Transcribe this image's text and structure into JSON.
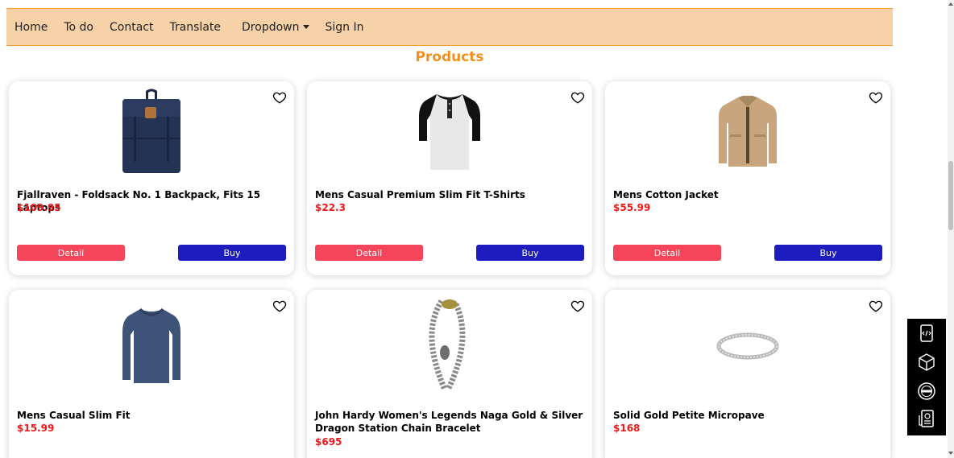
{
  "nav": {
    "items": [
      "Home",
      "To do",
      "Contact",
      "Translate"
    ],
    "dropdown_label": "Dropdown",
    "sign_in": "Sign In"
  },
  "page_title": "Products",
  "products": [
    {
      "title": "Fjallraven - Foldsack No. 1 Backpack, Fits 15 Laptops",
      "price": "$109.95",
      "image": "backpack"
    },
    {
      "title": "Mens Casual Premium Slim Fit T-Shirts",
      "price": "$22.3",
      "image": "henley-tshirt"
    },
    {
      "title": "Mens Cotton Jacket",
      "price": "$55.99",
      "image": "cotton-jacket"
    },
    {
      "title": "Mens Casual Slim Fit",
      "price": "$15.99",
      "image": "long-sleeve-shirt"
    },
    {
      "title": "John Hardy Women's Legends Naga Gold & Silver Dragon Station Chain Bracelet",
      "price": "$695",
      "image": "chain-bracelet"
    },
    {
      "title": "Solid Gold Petite Micropave",
      "price": "$168",
      "image": "ring"
    }
  ],
  "buttons": {
    "detail": "Detail",
    "buy": "Buy"
  },
  "side_widget": {
    "icons": [
      "code-icon",
      "cube-icon",
      "brand-icon",
      "certificate-icon"
    ]
  },
  "colors": {
    "nav_bg": "#f7d2a8",
    "title": "#f0901f",
    "price": "#f01818",
    "detail_button": "#f4455a",
    "buy_button": "#1c1cbf"
  }
}
